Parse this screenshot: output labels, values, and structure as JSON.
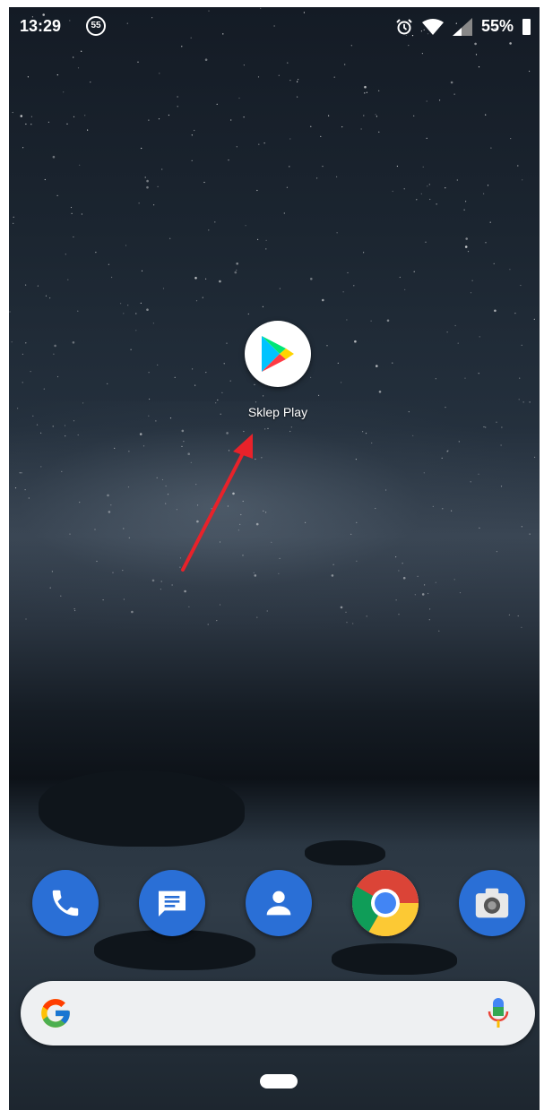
{
  "status_bar": {
    "time": "13:29",
    "notification_badge": "55",
    "battery_percent": "55%",
    "icons": [
      "alarm-icon",
      "wifi-icon",
      "signal-icon",
      "battery-icon"
    ]
  },
  "home_screen": {
    "app_icon": {
      "label": "Sklep Play",
      "icon": "google-play-icon"
    },
    "annotation": {
      "type": "arrow",
      "color": "#e8222a",
      "points_to": "Sklep Play"
    }
  },
  "dock": {
    "apps": [
      {
        "icon": "phone-icon",
        "color": "#2a6fd6"
      },
      {
        "icon": "messages-icon",
        "color": "#2a6fd6"
      },
      {
        "icon": "contacts-icon",
        "color": "#2a6fd6"
      },
      {
        "icon": "chrome-icon",
        "color": "#ffffff"
      },
      {
        "icon": "camera-icon",
        "color": "#2a6fd6"
      }
    ]
  },
  "search_bar": {
    "logo": "google-g-icon",
    "mic": "microphone-icon"
  },
  "navigation": {
    "home": "home-pill"
  }
}
